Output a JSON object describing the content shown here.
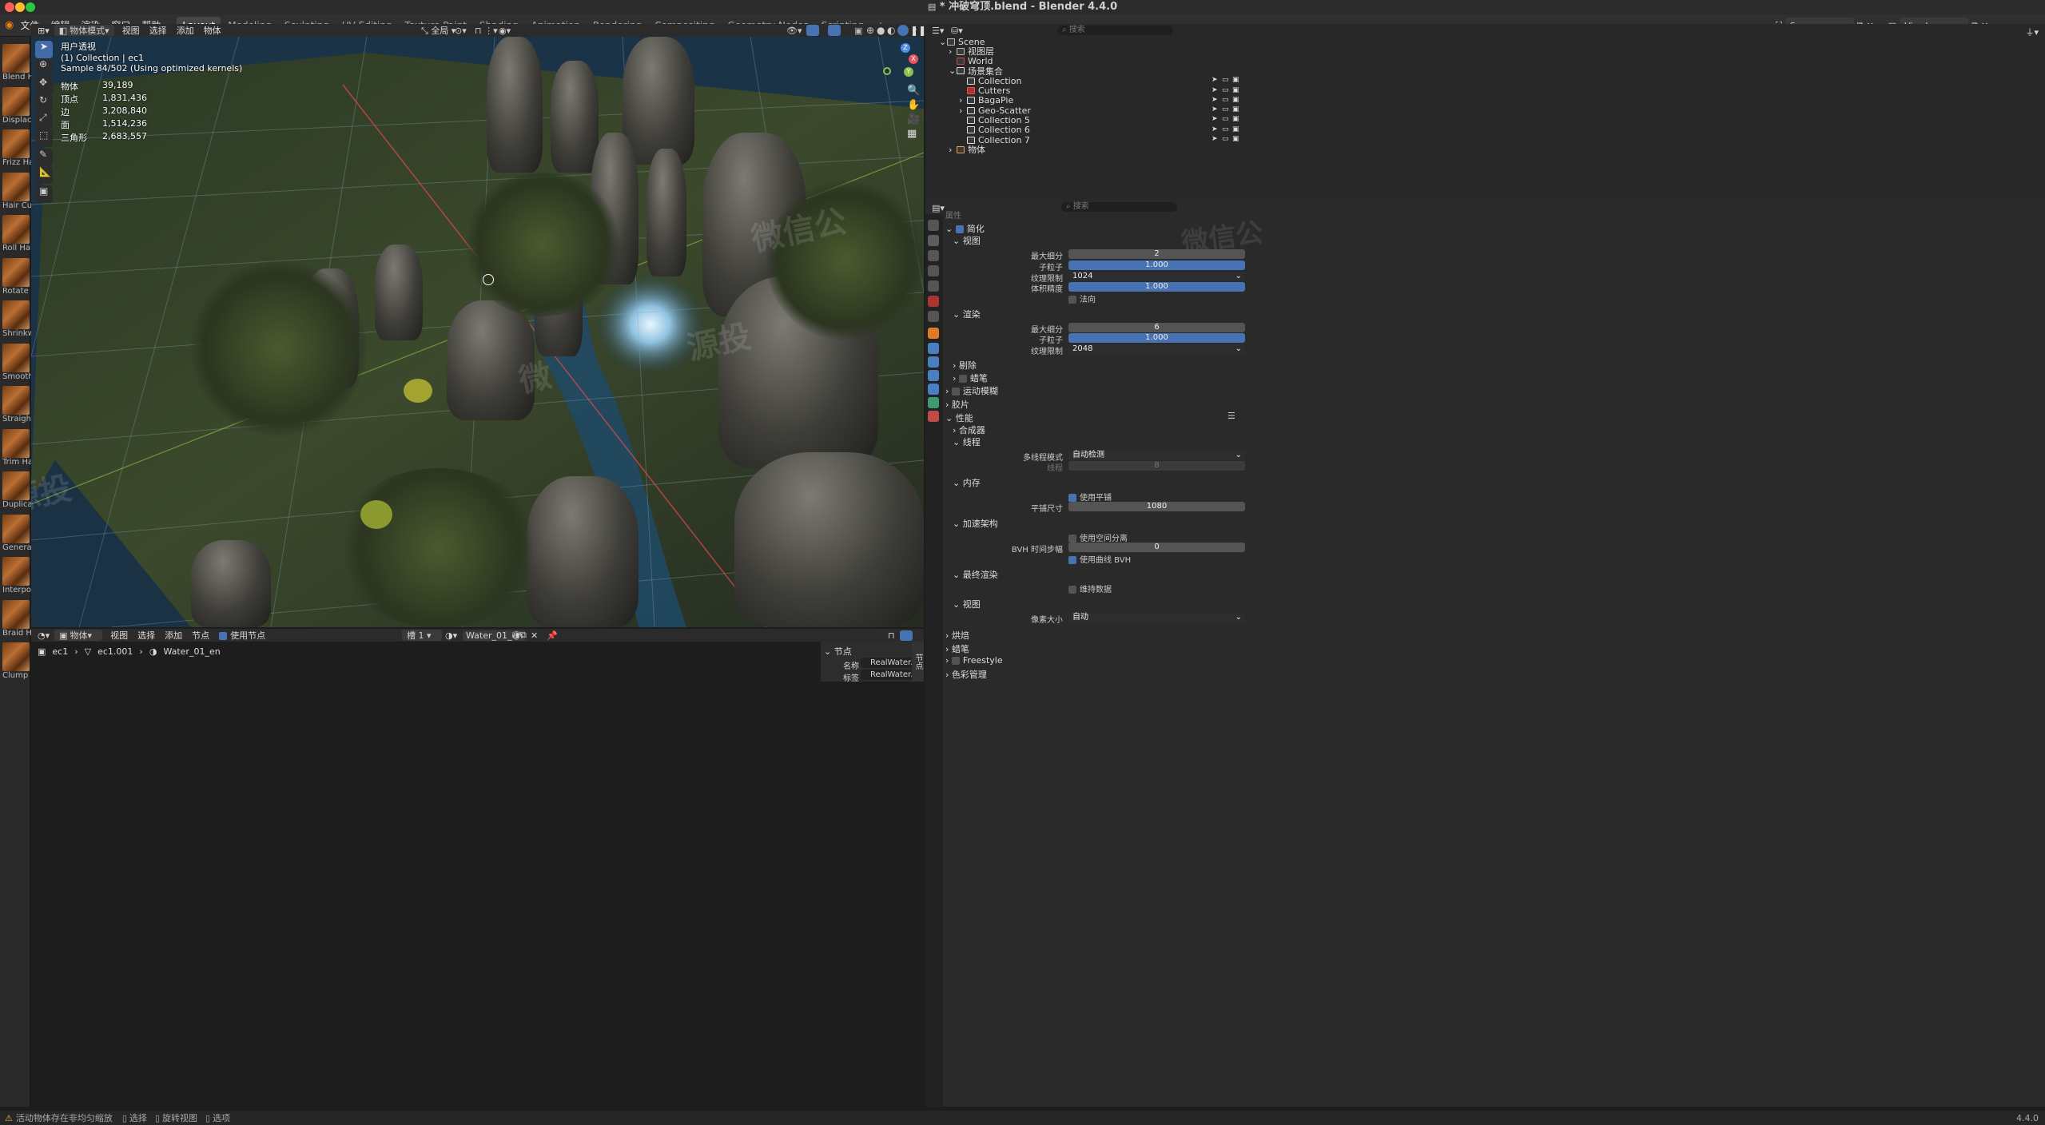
{
  "window": {
    "title": "* 冲破穹顶.blend - Blender 4.4.0",
    "colors": {
      "close": "#ff5f57",
      "minimize": "#febc2e",
      "maximize": "#28c840"
    }
  },
  "topbar": {
    "menus": [
      "文件",
      "编辑",
      "渲染",
      "窗口",
      "帮助"
    ],
    "workspaces": [
      "Layout",
      "Modeling",
      "Sculpting",
      "UV Editing",
      "Texture Paint",
      "Shading",
      "Animation",
      "Rendering",
      "Compositing",
      "Geometry Nodes",
      "Scripting"
    ],
    "active_workspace": "Layout",
    "add_tab": "+",
    "scene": "Scene",
    "view_layer": "ViewLayer"
  },
  "brushes": [
    "Blend Hair",
    "Displace H",
    "Frizz Hair",
    "Hair Curve",
    "Roll Hair C",
    "Rotate Hair",
    "Shrinkwra",
    "Smooth H",
    "Straighter",
    "Trim Hair",
    "Duplicate",
    "Generate H",
    "Interpolat",
    "Braid Hair",
    "Clump Hai"
  ],
  "viewport": {
    "mode": "物体模式",
    "menus": [
      "视图",
      "选择",
      "添加",
      "物体"
    ],
    "transform_orientation": "全局",
    "title": "用户透视",
    "collection": "(1) Collection | ec1",
    "sample": "Sample 84/502 (Using optimized kernels)",
    "stats": [
      {
        "label": "物体",
        "value": "39,189"
      },
      {
        "label": "顶点",
        "value": "1,831,436"
      },
      {
        "label": "边",
        "value": "3,208,840"
      },
      {
        "label": "面",
        "value": "1,514,236"
      },
      {
        "label": "三角形",
        "value": "2,683,557"
      }
    ],
    "watermarks": [
      "微信公",
      "源投",
      "微",
      "源投"
    ],
    "gizmo_axes": [
      "X",
      "Y",
      "Z"
    ],
    "colors": {
      "gizmo_x": "#e8535f",
      "gizmo_y": "#8bc34a",
      "gizmo_z": "#4f8fe8",
      "selected_tool": "#4772b3"
    }
  },
  "outliner": {
    "search_placeholder": "搜索",
    "items": [
      {
        "label": "Scene",
        "icon": "scene-icon"
      },
      {
        "label": "视图层",
        "icon": "view-layer-icon"
      },
      {
        "label": "World",
        "icon": "world-icon"
      },
      {
        "label": "场景集合",
        "icon": "collection-icon"
      },
      {
        "label": "Collection",
        "icon": "collection-icon"
      },
      {
        "label": "Cutters",
        "icon": "collection-red-icon"
      },
      {
        "label": "BagaPie",
        "icon": "collection-icon"
      },
      {
        "label": "Geo-Scatter",
        "icon": "collection-icon"
      },
      {
        "label": "Collection 5",
        "icon": "collection-icon"
      },
      {
        "label": "Collection 6",
        "icon": "collection-icon"
      },
      {
        "label": "Collection 7",
        "icon": "collection-icon"
      },
      {
        "label": "物体",
        "icon": "object-icon"
      }
    ]
  },
  "properties": {
    "search_placeholder": "搜索",
    "watermark": "微信公",
    "header_partial": "属性",
    "simplify": {
      "label": "简化",
      "checked": true
    },
    "sections": {
      "viewport": "视图",
      "render": "渲染",
      "culling": "剔除",
      "grease_pencil": "蜡笔",
      "motion_blur": "运动模糊",
      "film": "胶片",
      "performance": "性能",
      "compositor": "合成器",
      "threads": "线程",
      "memory": "内存",
      "accel": "加速架构",
      "final_render": "最终渲染",
      "viewport2": "视图",
      "bake": "烘焙",
      "grease_pencil2": "蜡笔",
      "freestyle": "Freestyle",
      "color_management": "色彩管理"
    },
    "fields": {
      "max_subdiv_label": "最大细分",
      "max_subdiv_vp": "2",
      "child_particles_label": "子粒子",
      "child_particles_vp": "1.000",
      "tex_limit_label": "纹理限制",
      "tex_limit_vp": "1024",
      "volume_res_label": "体积精度",
      "volume_res_vp": "1.000",
      "normals_label": "法向",
      "max_subdiv_render": "6",
      "child_particles_render": "1.000",
      "tex_limit_render": "2048",
      "thread_mode_label": "多线程模式",
      "thread_mode": "自动检测",
      "threads_label": "线程",
      "threads": "8",
      "use_tiling_label": "使用平铺",
      "tile_size_label": "平铺尺寸",
      "tile_size": "1080",
      "spatial_split_label": "使用空间分离",
      "bvh_steps_label": "BVH 时间步幅",
      "bvh_steps": "0",
      "curve_bvh_label": "使用曲线 BVH",
      "persistent_data_label": "维持数据",
      "pixel_size_label": "像素大小",
      "pixel_size": "自动"
    }
  },
  "node_editor": {
    "type": "物体",
    "menus": [
      "视图",
      "选择",
      "添加",
      "节点"
    ],
    "use_nodes_label": "使用节点",
    "slot": "槽 1",
    "material": "Water_01_en",
    "breadcrumb": [
      "ec1",
      "ec1.001",
      "Water_01_en"
    ],
    "panel_title": "节点",
    "name_label": "名称",
    "name_value": "RealWater...",
    "label_label": "标签",
    "label_value": "RealWater...",
    "side_tab": "节点"
  },
  "statusbar": {
    "message": "活动物体存在非均匀缩放",
    "hints": [
      "选择",
      "旋转视图",
      "选项"
    ],
    "version": "4.4.0"
  }
}
